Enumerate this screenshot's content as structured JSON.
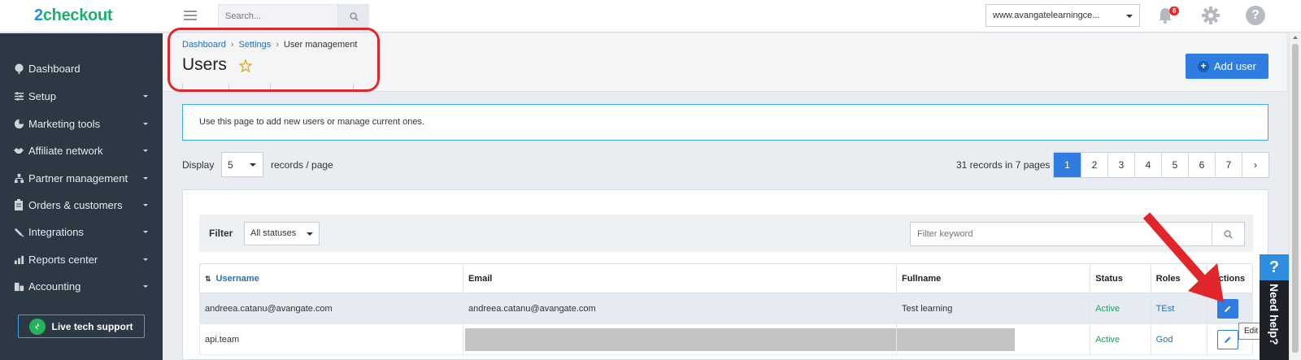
{
  "brand": {
    "logo_prefix": "2",
    "logo_rest": "checkout"
  },
  "topbar": {
    "search_placeholder": "Search...",
    "account": "www.avangatelearningce...",
    "notifications_count": "6"
  },
  "sidebar": {
    "items": [
      {
        "label": "Dashboard",
        "icon": "dashboard-icon",
        "has_caret": false
      },
      {
        "label": "Setup",
        "icon": "setup-icon",
        "has_caret": true
      },
      {
        "label": "Marketing tools",
        "icon": "pie-chart-icon",
        "has_caret": true
      },
      {
        "label": "Affiliate network",
        "icon": "handshake-icon",
        "has_caret": true
      },
      {
        "label": "Partner management",
        "icon": "org-chart-icon",
        "has_caret": true
      },
      {
        "label": "Orders & customers",
        "icon": "clipboard-icon",
        "has_caret": true
      },
      {
        "label": "Integrations",
        "icon": "plug-icon",
        "has_caret": true
      },
      {
        "label": "Reports center",
        "icon": "bar-chart-icon",
        "has_caret": true
      },
      {
        "label": "Accounting",
        "icon": "accounting-icon",
        "has_caret": true
      }
    ],
    "live_support": "Live tech support"
  },
  "header": {
    "breadcrumb": [
      "Dashboard",
      "Settings",
      "User management"
    ],
    "title": "Users",
    "add_user": "Add user"
  },
  "info": "Use this page to add new users or manage current ones.",
  "listing": {
    "display_label": "Display",
    "per_page": "5",
    "records_label": "records / page",
    "records_count": "31 records in 7 pages",
    "pages": [
      "1",
      "2",
      "3",
      "4",
      "5",
      "6",
      "7",
      "›"
    ],
    "active_page": "1"
  },
  "filter": {
    "label": "Filter",
    "status": "All statuses",
    "keyword_placeholder": "Filter keyword"
  },
  "table": {
    "columns": [
      "Username",
      "Email",
      "Fullname",
      "Status",
      "Roles",
      "Actions"
    ],
    "rows": [
      {
        "username": "andreea.catanu@avangate.com",
        "email": "andreea.catanu@avangate.com",
        "fullname": "Test learning",
        "status": "Active",
        "role": "TEst"
      },
      {
        "username": "api.team",
        "email": "",
        "fullname": "",
        "status": "Active",
        "role": "God"
      }
    ]
  },
  "tooltip": "Edit",
  "need_help": {
    "q": "?",
    "label": "Need help?"
  },
  "colors": {
    "accent": "#2f7de1",
    "active_status": "#1aa75a",
    "sidebar_bg": "#2d3845",
    "highlight": "#e0262b"
  }
}
